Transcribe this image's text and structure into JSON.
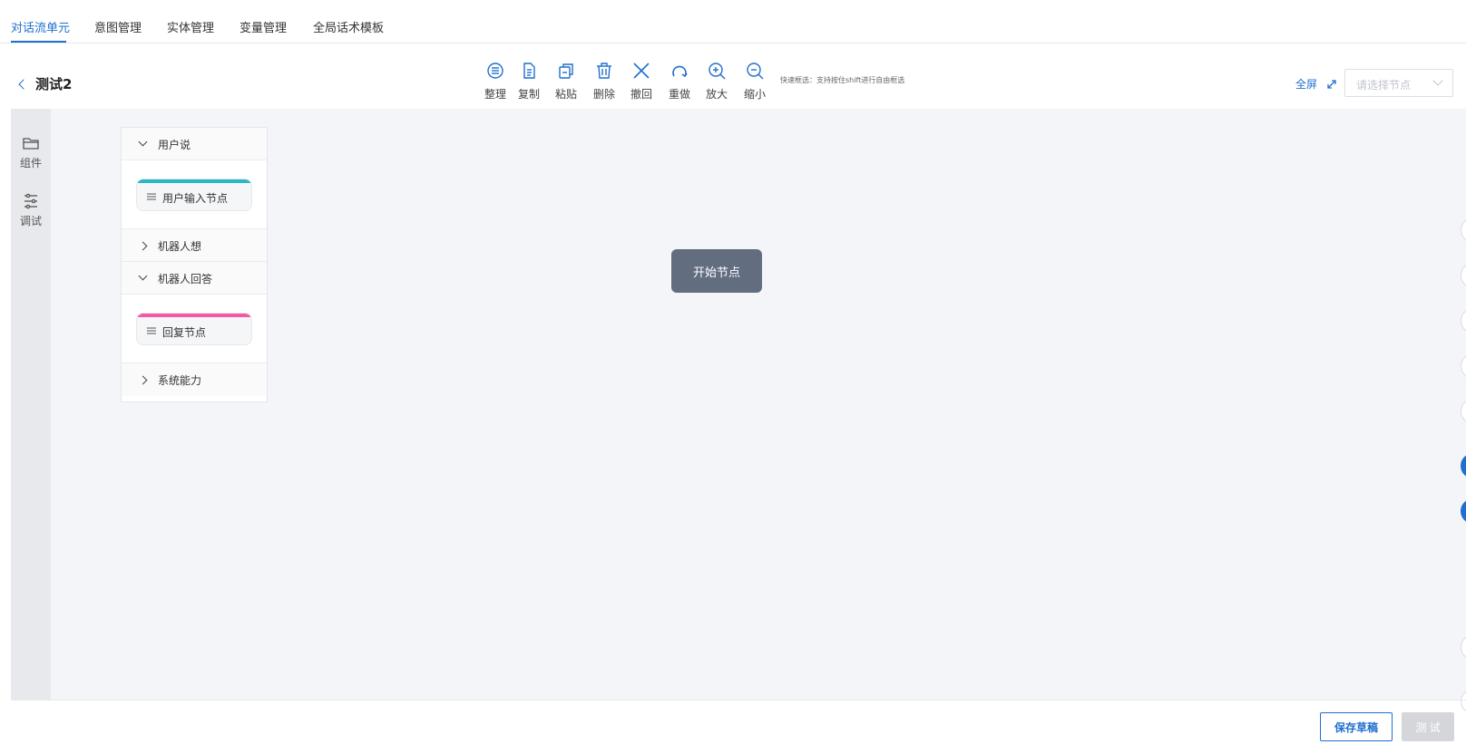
{
  "tabs": [
    "对话流单元",
    "意图管理",
    "实体管理",
    "变量管理",
    "全局话术模板"
  ],
  "header": {
    "title": "测试2",
    "fullscreen_label": "全屏",
    "node_select_placeholder": "请选择节点"
  },
  "toolbar": {
    "tools": [
      {
        "label": "整理",
        "icon": "organize-icon"
      },
      {
        "label": "复制",
        "icon": "copy-icon"
      },
      {
        "label": "粘贴",
        "icon": "paste-icon"
      },
      {
        "label": "删除",
        "icon": "delete-icon"
      },
      {
        "label": "撤回",
        "icon": "undo-icon"
      },
      {
        "label": "重做",
        "icon": "redo-icon"
      },
      {
        "label": "放大",
        "icon": "zoom-in-icon"
      },
      {
        "label": "缩小",
        "icon": "zoom-out-icon"
      }
    ],
    "quick_tip": "快速框选：支持按住shift进行自由框选"
  },
  "rail": {
    "items": [
      {
        "label": "组件",
        "icon": "folder-icon"
      },
      {
        "label": "调试",
        "icon": "sliders-icon"
      }
    ]
  },
  "palette": {
    "groups": [
      {
        "title": "用户说",
        "expanded": true,
        "nodes": [
          {
            "label": "用户输入节点",
            "color": "#2bb8c4"
          }
        ]
      },
      {
        "title": "机器人想",
        "expanded": false,
        "nodes": []
      },
      {
        "title": "机器人回答",
        "expanded": true,
        "nodes": [
          {
            "label": "回复节点",
            "color": "#f25aa6"
          }
        ]
      },
      {
        "title": "系统能力",
        "expanded": false,
        "nodes": []
      }
    ]
  },
  "canvas": {
    "start_node_label": "开始节点"
  },
  "footer": {
    "save_label": "保存草稿",
    "test_label": "测 试"
  },
  "colors": {
    "accent": "#1f6fce",
    "start_node": "#626d80",
    "canvas_bg": "#f4f5f8"
  }
}
